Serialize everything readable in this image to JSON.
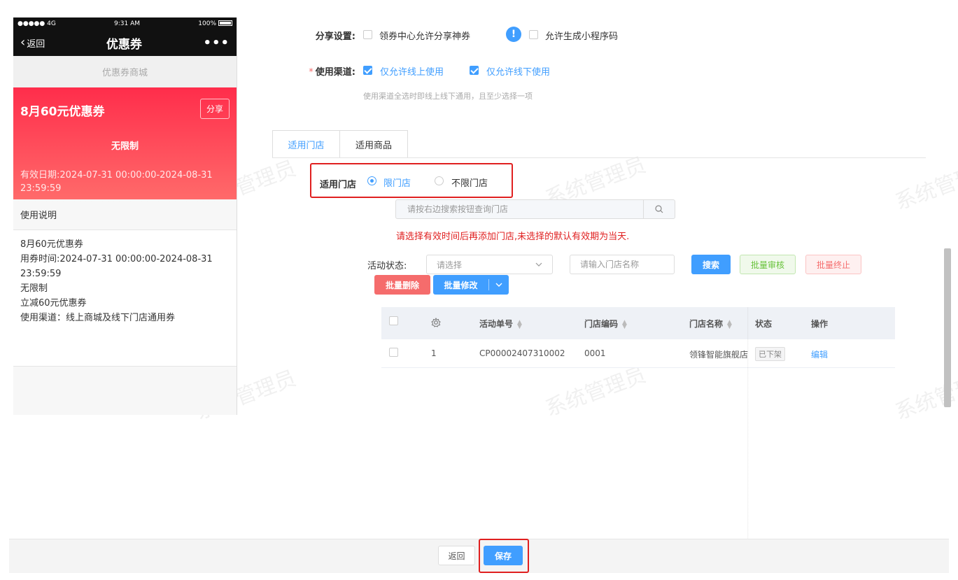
{
  "watermark": "系统管理员",
  "phone": {
    "status": {
      "signal": "●●●●● 4G",
      "time": "9:31 AM",
      "battery": "100%"
    },
    "nav": {
      "back": "返回",
      "title": "优惠券",
      "more": "•••"
    },
    "mall_title": "优惠券商城",
    "coupon": {
      "name": "8月60元优惠券",
      "share": "分享",
      "limit": "无限制",
      "valid_line1": "有效日期:2024-07-31 00:00:00-2024-08-31",
      "valid_line2": "23:59:59"
    },
    "usage_title": "使用说明",
    "details": [
      "8月60元优惠券",
      "用券时间:2024-07-31 00:00:00-2024-08-31",
      "23:59:59",
      "无限制",
      "立减60元优惠券",
      "使用渠道：线上商城及线下门店通用券"
    ]
  },
  "form": {
    "share_label": "分享设置:",
    "share_opt1": "领券中心允许分享神券",
    "share_info_icon": "!",
    "share_opt2": "允许生成小程序码",
    "channel_required": "*",
    "channel_label": "使用渠道:",
    "channel_opt1": "仅允许线上使用",
    "channel_opt2": "仅允许线下使用",
    "channel_hint": "使用渠道全选时即线上线下通用，且至少选择一项"
  },
  "tabs": [
    "适用门店",
    "适用商品"
  ],
  "store": {
    "label": "适用门店",
    "opt_limit": "限门店",
    "opt_unlimit": "不限门店",
    "search_placeholder": "请按右边搜索按钮查询门店",
    "warning": "请选择有效时间后再添加门店,未选择的默认有效期为当天.",
    "status_label": "活动状态:",
    "status_placeholder": "请选择",
    "name_placeholder": "请输入门店名称",
    "btn_search": "搜索",
    "btn_batch_review": "批量审核",
    "btn_batch_stop": "批量终止",
    "btn_batch_delete": "批量删除",
    "btn_batch_edit": "批量修改"
  },
  "table": {
    "headers": {
      "no": "活动单号",
      "code": "门店编码",
      "name": "门店名称",
      "status": "状态",
      "action": "操作"
    },
    "rows": [
      {
        "index": "1",
        "no": "CP00002407310002",
        "code": "0001",
        "name": "领锋智能旗舰店",
        "status": "已下架",
        "action": "编辑"
      }
    ]
  },
  "footer": {
    "back": "返回",
    "save": "保存"
  },
  "colors": {
    "primary": "#409eff",
    "highlight": "#e02020",
    "coupon": "#ff2d4b"
  }
}
